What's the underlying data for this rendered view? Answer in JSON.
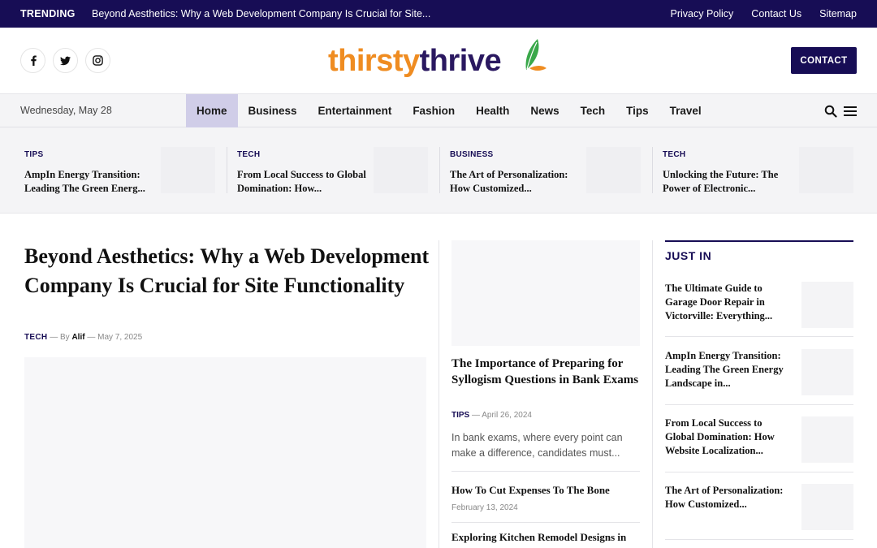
{
  "topbar": {
    "trending_label": "TRENDING",
    "ticker": "Beyond Aesthetics: Why a Web Development Company Is Crucial for Site...",
    "links": [
      "Privacy Policy",
      "Contact Us",
      "Sitemap"
    ]
  },
  "header": {
    "social_icons": [
      "facebook-icon",
      "twitter-icon",
      "instagram-icon"
    ],
    "logo_part1": "thirsty",
    "logo_part2": "thrive",
    "contact_label": "CONTACT",
    "colors": {
      "brand_navy": "#170d55",
      "logo_orange": "#ef8c21",
      "logo_green": "#3aa84a"
    }
  },
  "nav": {
    "date": "Wednesday, May 28",
    "items": [
      "Home",
      "Business",
      "Entertainment",
      "Fashion",
      "Health",
      "News",
      "Tech",
      "Tips",
      "Travel"
    ],
    "active": "Home"
  },
  "featured": [
    {
      "category": "TIPS",
      "title": "AmpIn Energy Transition: Leading The Green Energ..."
    },
    {
      "category": "TECH",
      "title": "From Local Success to Global Domination: How..."
    },
    {
      "category": "BUSINESS",
      "title": "The Art of Personalization: How Customized..."
    },
    {
      "category": "TECH",
      "title": "Unlocking the Future: The Power of Electronic..."
    }
  ],
  "main": {
    "title": "Beyond Aesthetics: Why a Web Development Company Is Crucial for Site Functionality",
    "category": "TECH",
    "by": "By",
    "author": "Alif",
    "date": "May 7, 2025"
  },
  "middle": {
    "title": "The Importance of Preparing for Syllogism Questions in Bank Exams",
    "category": "TIPS",
    "date": "April 26, 2024",
    "excerpt": "In bank exams, where every point can make a difference, candidates must...",
    "list": [
      {
        "title": "How To Cut Expenses To The Bone",
        "date": "February 13, 2024"
      },
      {
        "title": "Exploring Kitchen Remodel Designs in"
      }
    ]
  },
  "sidebar": {
    "heading": "JUST IN",
    "items": [
      {
        "title": "The Ultimate Guide to Garage Door Repair in Victorville: Everything..."
      },
      {
        "title": "AmpIn Energy Transition: Leading The Green Energy Landscape in..."
      },
      {
        "title": "From Local Success to Global Domination: How Website Localization..."
      },
      {
        "title": "The Art of Personalization: How Customized..."
      }
    ]
  }
}
